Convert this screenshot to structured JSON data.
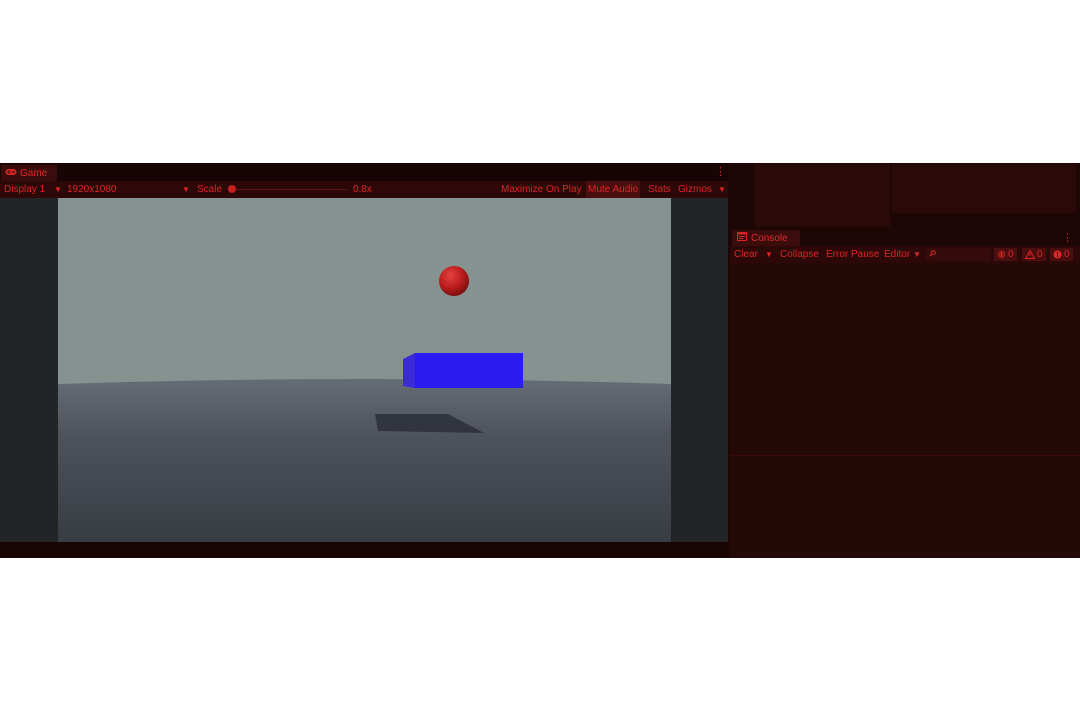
{
  "game": {
    "tab_label": "Game",
    "icon": "gamepad-icon",
    "toolbar": {
      "display": "Display 1",
      "resolution": "1920x1080",
      "scale_label": "Scale",
      "scale_value": "0.8x",
      "scale_fraction": 0.0,
      "maximize": "Maximize On Play",
      "mute": "Mute Audio",
      "stats": "Stats",
      "gizmos": "Gizmos"
    }
  },
  "console": {
    "tab_label": "Console",
    "icon": "console-icon",
    "toolbar": {
      "clear": "Clear",
      "collapse": "Collapse",
      "error_pause": "Error Pause",
      "editor": "Editor",
      "search_icon": "search-icon"
    },
    "counts": {
      "log": "0",
      "warning": "0",
      "error": "0"
    }
  },
  "colors": {
    "accent": "#dd2626",
    "panel": "#250909",
    "toolbar": "#2c0808",
    "sky": "#869290",
    "ground": "#3e424a",
    "sphere": "#b81c1c",
    "box": "#2a1cf0"
  }
}
